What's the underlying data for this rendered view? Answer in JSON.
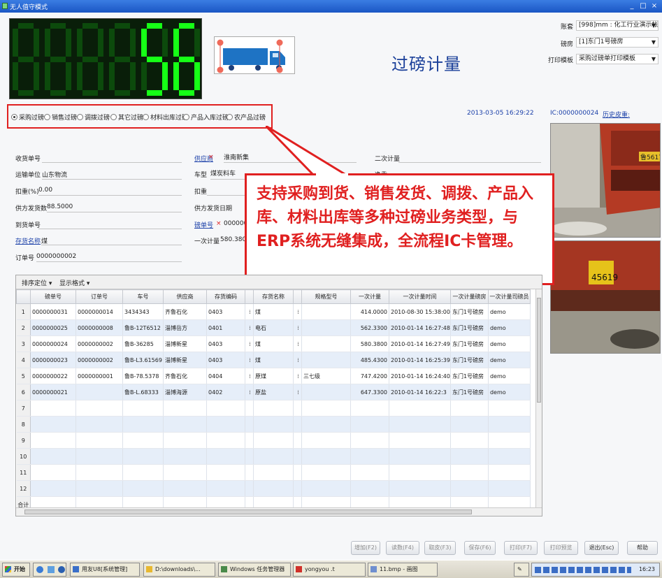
{
  "window": {
    "title": "无人值守模式"
  },
  "led": {
    "digits": [
      "8",
      "8",
      "8",
      "8",
      "5",
      "6"
    ],
    "lit": [
      false,
      false,
      false,
      false,
      true,
      true
    ]
  },
  "main_title": "过磅计量",
  "right_top": {
    "company_label": "账套",
    "company_value": "[998]mm : 化工行业演示帐套",
    "scale_label": "磅房",
    "scale_value": "[1]东门1号磅房",
    "print_label": "打印模板",
    "print_value": "采购过磅单打印模板"
  },
  "radios": [
    {
      "label": "采购过磅",
      "checked": true
    },
    {
      "label": "销售过磅",
      "checked": false
    },
    {
      "label": "调拨过磅",
      "checked": false
    },
    {
      "label": "其它过磅",
      "checked": false
    },
    {
      "label": "材料出库过磅",
      "checked": false
    },
    {
      "label": "产品入库过磅",
      "checked": false
    },
    {
      "label": "农产品过磅",
      "checked": false
    }
  ],
  "status": {
    "datetime": "2013-03-05 16:29:22",
    "card": "IC:0000000024",
    "history": "历史皮重:"
  },
  "form": {
    "f1_label": "收货单号",
    "f2_label": "运输单位",
    "f2_value": "山东物流",
    "f3_label": "扣重(%)",
    "f3_value": "0.00",
    "f4_label": "供方发货数",
    "f4_value": "88.5000",
    "f5_label": "到货单号",
    "f6_label": "存货名称",
    "f6_value": "煤",
    "f7_label": "订单号",
    "f7_value": "0000000002",
    "m1_label": "供应商",
    "m1_value": "淮南新集",
    "m2_label": "车型",
    "m2_value": "煤炭料车",
    "m3_label": "扣重",
    "m4_label": "供方发货日期",
    "m5_label": "磅单号",
    "m5_value": "0000000",
    "m6_label": "一次计量",
    "m6_value": "580.3800",
    "r1_label": "二次计量",
    "r2_label": "净重"
  },
  "callout": {
    "text": "支持采购到货、销售发货、调拨、产品入库、材料出库等多种过磅业务类型，与ERP系统无缝集成，全流程IC卡管理。"
  },
  "grid": {
    "toolbar": {
      "sort": "排序定位",
      "display": "显示格式"
    },
    "headers": [
      "",
      "磅单号",
      "订单号",
      "车号",
      "供应商",
      "存货编码",
      "",
      "存货名称",
      "",
      "规格型号",
      "一次计量",
      "一次计量时间",
      "一次计量磅房",
      "一次计量司磅员"
    ],
    "rows": [
      [
        "1",
        "0000000031",
        "0000000014",
        "3434343",
        "齐鲁石化",
        "0403",
        "煤",
        "",
        "414.0000",
        "2010-08-30 15:38:00",
        "东门1号磅房",
        "demo"
      ],
      [
        "2",
        "0000000025",
        "0000000008",
        "鲁B-12T6512",
        "淄博岳方",
        "0401",
        "电石",
        "",
        "562.3300",
        "2010-01-14 16:27:48",
        "东门1号磅房",
        "demo"
      ],
      [
        "3",
        "0000000024",
        "0000000002",
        "鲁B-36285",
        "淄博新星",
        "0403",
        "煤",
        "",
        "580.3800",
        "2010-01-14 16:27:49",
        "东门1号磅房",
        "demo"
      ],
      [
        "4",
        "0000000023",
        "0000000002",
        "鲁B-L3.61569",
        "淄博新星",
        "0403",
        "煤",
        "",
        "485.4300",
        "2010-01-14 16:25:39",
        "东门1号磅房",
        "demo"
      ],
      [
        "5",
        "0000000022",
        "0000000001",
        "鲁B-78.5378",
        "齐鲁石化",
        "0404",
        "原煤",
        "三七级",
        "747.4200",
        "2010-01-14 16:24:40",
        "东门1号磅房",
        "demo"
      ],
      [
        "6",
        "0000000021",
        "",
        "鲁B-L.68333",
        "淄博海源",
        "0402",
        "原盐",
        "",
        "647.3300",
        "2010-01-14 16:22:3",
        "东门1号磅房",
        "demo"
      ],
      [
        "7",
        "",
        "",
        "",
        "",
        "",
        "",
        "",
        "",
        "",
        "",
        ""
      ],
      [
        "8",
        "",
        "",
        "",
        "",
        "",
        "",
        "",
        "",
        "",
        "",
        ""
      ],
      [
        "9",
        "",
        "",
        "",
        "",
        "",
        "",
        "",
        "",
        "",
        "",
        ""
      ],
      [
        "10",
        "",
        "",
        "",
        "",
        "",
        "",
        "",
        "",
        "",
        "",
        ""
      ],
      [
        "11",
        "",
        "",
        "",
        "",
        "",
        "",
        "",
        "",
        "",
        "",
        ""
      ],
      [
        "12",
        "",
        "",
        "",
        "",
        "",
        "",
        "",
        "",
        "",
        "",
        ""
      ],
      [
        "合计",
        "",
        "",
        "",
        "",
        "",
        "",
        "",
        "",
        "",
        "",
        ""
      ]
    ]
  },
  "buttons": [
    "增加(F2)",
    "读数(F4)",
    "取皮(F3)",
    "保存(F6)",
    "打印(F7)",
    "打印预览",
    "退出(Esc)",
    "帮助"
  ],
  "taskbar": {
    "start": "开始",
    "items": [
      "用友U8[系统管理]",
      "D:\\downloads\\... ",
      "Windows 任务管理器",
      "yongyou .t",
      "11.bmp - 画图"
    ],
    "clock": "16:23"
  },
  "colors": {
    "led_on": "#16ff16",
    "led_off": "#0c4a0c",
    "accent": "#e02020",
    "title": "#1a3f99"
  }
}
